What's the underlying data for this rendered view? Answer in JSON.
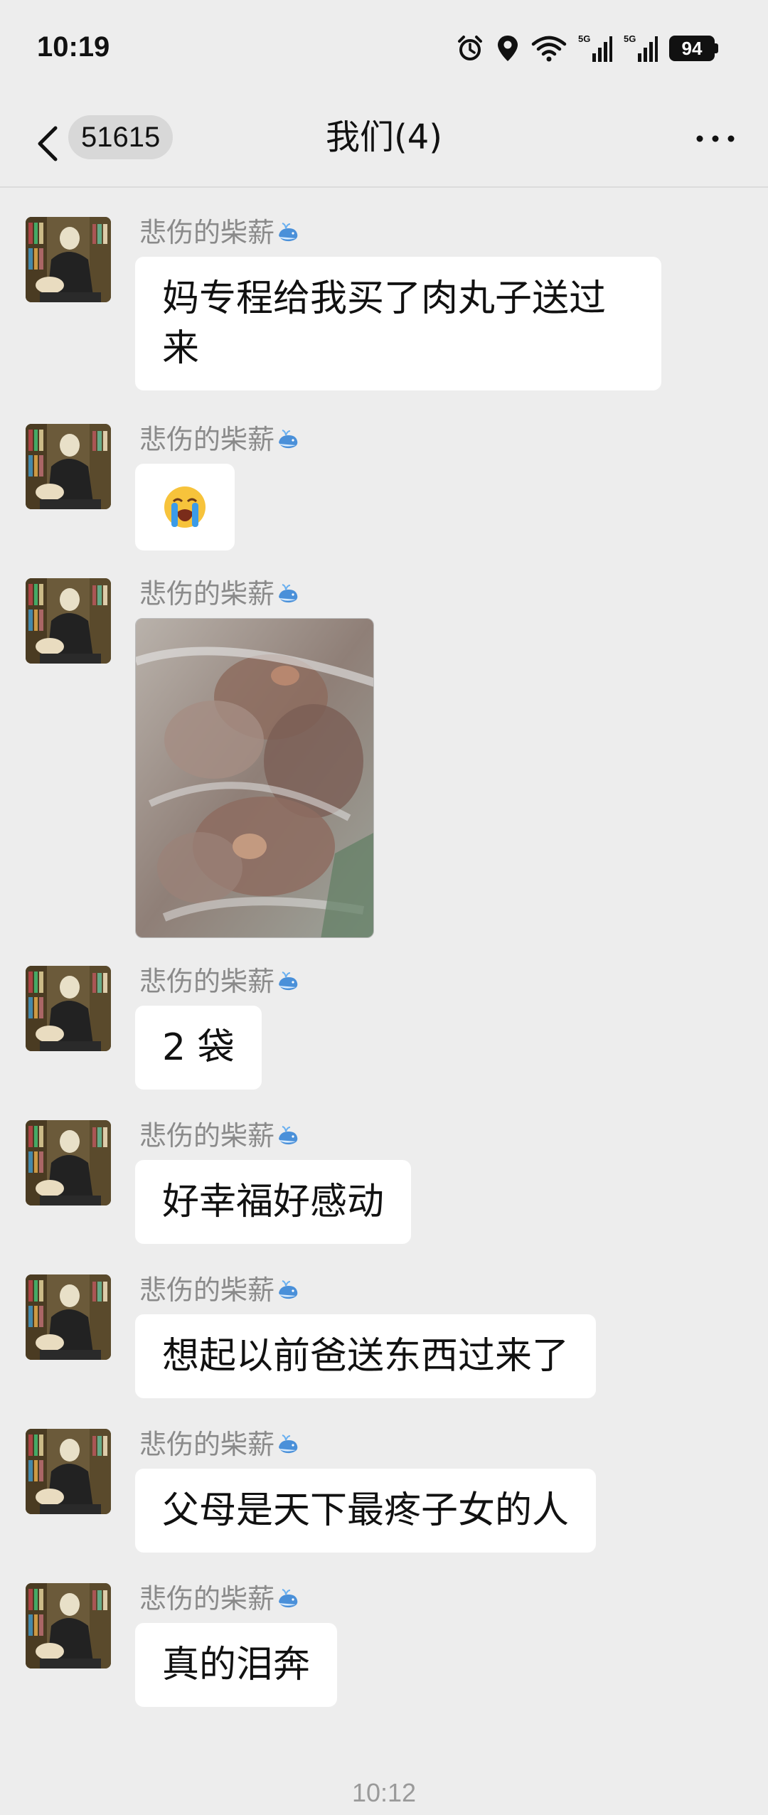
{
  "status": {
    "time": "10:19",
    "battery": "94",
    "net1": "5G",
    "net2": "5G"
  },
  "nav": {
    "unread_count": "51615",
    "title": "我们(4)"
  },
  "sender_name": "悲伤的柴薪",
  "messages": [
    {
      "type": "text",
      "text": "妈专程给我买了肉丸子送过来"
    },
    {
      "type": "emoji",
      "emoji": "😭"
    },
    {
      "type": "image"
    },
    {
      "type": "text",
      "text": "2 袋"
    },
    {
      "type": "text",
      "text": "好幸福好感动"
    },
    {
      "type": "text",
      "text": "想起以前爸送东西过来了"
    },
    {
      "type": "text",
      "text": "父母是天下最疼子女的人"
    },
    {
      "type": "text",
      "text": "真的泪奔"
    }
  ],
  "footer_timestamp": "10:12",
  "colors": {
    "background": "#ededed",
    "bubble": "#ffffff",
    "sender": "#8a8a8a"
  }
}
